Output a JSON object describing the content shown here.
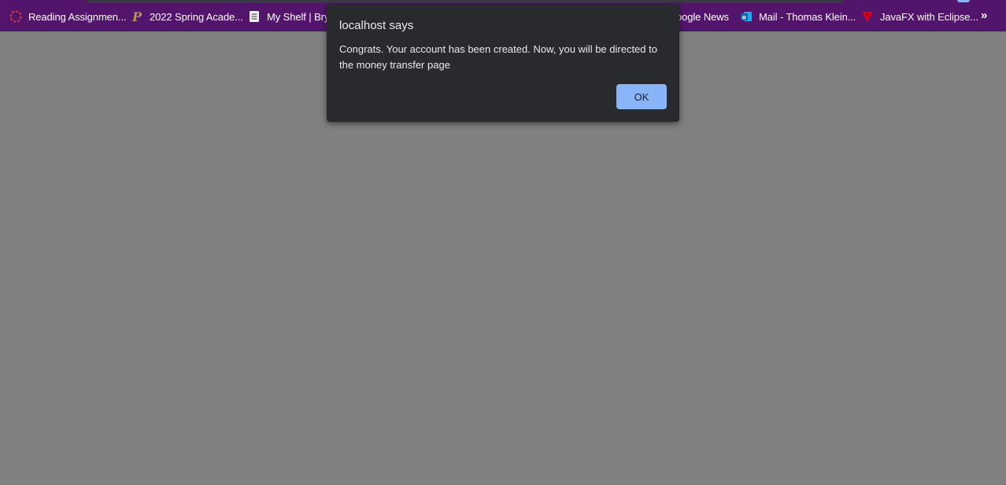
{
  "bookmarks": [
    {
      "label": "Reading Assignmen...",
      "icon": "reading-assignment-icon"
    },
    {
      "label": "2022 Spring Acade...",
      "icon": "p-logo-icon"
    },
    {
      "label": "My Shelf | Bryt",
      "icon": "document-icon"
    },
    {
      "label": "oogle News",
      "icon": ""
    },
    {
      "label": "Mail - Thomas Klein...",
      "icon": "outlook-icon"
    },
    {
      "label": "JavaFX with Eclipse...",
      "icon": "vivaldi-icon"
    }
  ],
  "more_bookmarks": "»",
  "dialog": {
    "title": "localhost says",
    "message": "Congrats. Your account has been created. Now, you will be directed to the money transfer page",
    "ok_label": "OK"
  },
  "colors": {
    "bookmarks_bar": "#53156b",
    "page_overlay": "#808080",
    "dialog_bg": "#292a2d",
    "ok_button": "#8ab4f8"
  }
}
